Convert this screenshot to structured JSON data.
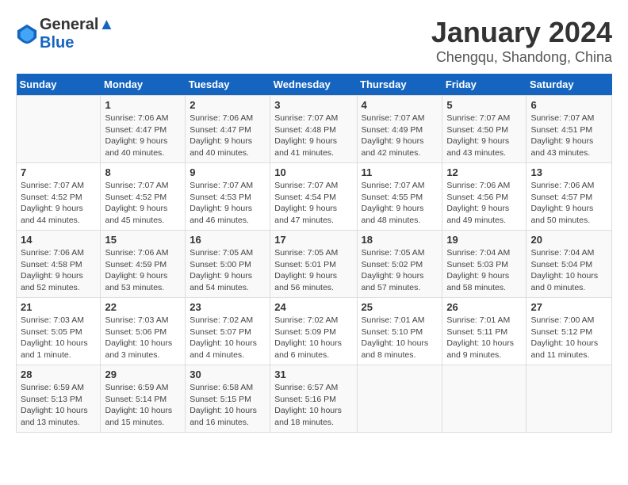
{
  "header": {
    "logo_line1": "General",
    "logo_line2": "Blue",
    "month": "January 2024",
    "location": "Chengqu, Shandong, China"
  },
  "weekdays": [
    "Sunday",
    "Monday",
    "Tuesday",
    "Wednesday",
    "Thursday",
    "Friday",
    "Saturday"
  ],
  "weeks": [
    [
      {
        "day": "",
        "sunrise": "",
        "sunset": "",
        "daylight": ""
      },
      {
        "day": "1",
        "sunrise": "Sunrise: 7:06 AM",
        "sunset": "Sunset: 4:47 PM",
        "daylight": "Daylight: 9 hours and 40 minutes."
      },
      {
        "day": "2",
        "sunrise": "Sunrise: 7:06 AM",
        "sunset": "Sunset: 4:47 PM",
        "daylight": "Daylight: 9 hours and 40 minutes."
      },
      {
        "day": "3",
        "sunrise": "Sunrise: 7:07 AM",
        "sunset": "Sunset: 4:48 PM",
        "daylight": "Daylight: 9 hours and 41 minutes."
      },
      {
        "day": "4",
        "sunrise": "Sunrise: 7:07 AM",
        "sunset": "Sunset: 4:49 PM",
        "daylight": "Daylight: 9 hours and 42 minutes."
      },
      {
        "day": "5",
        "sunrise": "Sunrise: 7:07 AM",
        "sunset": "Sunset: 4:50 PM",
        "daylight": "Daylight: 9 hours and 43 minutes."
      },
      {
        "day": "6",
        "sunrise": "Sunrise: 7:07 AM",
        "sunset": "Sunset: 4:51 PM",
        "daylight": "Daylight: 9 hours and 43 minutes."
      }
    ],
    [
      {
        "day": "7",
        "sunrise": "Sunrise: 7:07 AM",
        "sunset": "Sunset: 4:52 PM",
        "daylight": "Daylight: 9 hours and 44 minutes."
      },
      {
        "day": "8",
        "sunrise": "Sunrise: 7:07 AM",
        "sunset": "Sunset: 4:52 PM",
        "daylight": "Daylight: 9 hours and 45 minutes."
      },
      {
        "day": "9",
        "sunrise": "Sunrise: 7:07 AM",
        "sunset": "Sunset: 4:53 PM",
        "daylight": "Daylight: 9 hours and 46 minutes."
      },
      {
        "day": "10",
        "sunrise": "Sunrise: 7:07 AM",
        "sunset": "Sunset: 4:54 PM",
        "daylight": "Daylight: 9 hours and 47 minutes."
      },
      {
        "day": "11",
        "sunrise": "Sunrise: 7:07 AM",
        "sunset": "Sunset: 4:55 PM",
        "daylight": "Daylight: 9 hours and 48 minutes."
      },
      {
        "day": "12",
        "sunrise": "Sunrise: 7:06 AM",
        "sunset": "Sunset: 4:56 PM",
        "daylight": "Daylight: 9 hours and 49 minutes."
      },
      {
        "day": "13",
        "sunrise": "Sunrise: 7:06 AM",
        "sunset": "Sunset: 4:57 PM",
        "daylight": "Daylight: 9 hours and 50 minutes."
      }
    ],
    [
      {
        "day": "14",
        "sunrise": "Sunrise: 7:06 AM",
        "sunset": "Sunset: 4:58 PM",
        "daylight": "Daylight: 9 hours and 52 minutes."
      },
      {
        "day": "15",
        "sunrise": "Sunrise: 7:06 AM",
        "sunset": "Sunset: 4:59 PM",
        "daylight": "Daylight: 9 hours and 53 minutes."
      },
      {
        "day": "16",
        "sunrise": "Sunrise: 7:05 AM",
        "sunset": "Sunset: 5:00 PM",
        "daylight": "Daylight: 9 hours and 54 minutes."
      },
      {
        "day": "17",
        "sunrise": "Sunrise: 7:05 AM",
        "sunset": "Sunset: 5:01 PM",
        "daylight": "Daylight: 9 hours and 56 minutes."
      },
      {
        "day": "18",
        "sunrise": "Sunrise: 7:05 AM",
        "sunset": "Sunset: 5:02 PM",
        "daylight": "Daylight: 9 hours and 57 minutes."
      },
      {
        "day": "19",
        "sunrise": "Sunrise: 7:04 AM",
        "sunset": "Sunset: 5:03 PM",
        "daylight": "Daylight: 9 hours and 58 minutes."
      },
      {
        "day": "20",
        "sunrise": "Sunrise: 7:04 AM",
        "sunset": "Sunset: 5:04 PM",
        "daylight": "Daylight: 10 hours and 0 minutes."
      }
    ],
    [
      {
        "day": "21",
        "sunrise": "Sunrise: 7:03 AM",
        "sunset": "Sunset: 5:05 PM",
        "daylight": "Daylight: 10 hours and 1 minute."
      },
      {
        "day": "22",
        "sunrise": "Sunrise: 7:03 AM",
        "sunset": "Sunset: 5:06 PM",
        "daylight": "Daylight: 10 hours and 3 minutes."
      },
      {
        "day": "23",
        "sunrise": "Sunrise: 7:02 AM",
        "sunset": "Sunset: 5:07 PM",
        "daylight": "Daylight: 10 hours and 4 minutes."
      },
      {
        "day": "24",
        "sunrise": "Sunrise: 7:02 AM",
        "sunset": "Sunset: 5:09 PM",
        "daylight": "Daylight: 10 hours and 6 minutes."
      },
      {
        "day": "25",
        "sunrise": "Sunrise: 7:01 AM",
        "sunset": "Sunset: 5:10 PM",
        "daylight": "Daylight: 10 hours and 8 minutes."
      },
      {
        "day": "26",
        "sunrise": "Sunrise: 7:01 AM",
        "sunset": "Sunset: 5:11 PM",
        "daylight": "Daylight: 10 hours and 9 minutes."
      },
      {
        "day": "27",
        "sunrise": "Sunrise: 7:00 AM",
        "sunset": "Sunset: 5:12 PM",
        "daylight": "Daylight: 10 hours and 11 minutes."
      }
    ],
    [
      {
        "day": "28",
        "sunrise": "Sunrise: 6:59 AM",
        "sunset": "Sunset: 5:13 PM",
        "daylight": "Daylight: 10 hours and 13 minutes."
      },
      {
        "day": "29",
        "sunrise": "Sunrise: 6:59 AM",
        "sunset": "Sunset: 5:14 PM",
        "daylight": "Daylight: 10 hours and 15 minutes."
      },
      {
        "day": "30",
        "sunrise": "Sunrise: 6:58 AM",
        "sunset": "Sunset: 5:15 PM",
        "daylight": "Daylight: 10 hours and 16 minutes."
      },
      {
        "day": "31",
        "sunrise": "Sunrise: 6:57 AM",
        "sunset": "Sunset: 5:16 PM",
        "daylight": "Daylight: 10 hours and 18 minutes."
      },
      {
        "day": "",
        "sunrise": "",
        "sunset": "",
        "daylight": ""
      },
      {
        "day": "",
        "sunrise": "",
        "sunset": "",
        "daylight": ""
      },
      {
        "day": "",
        "sunrise": "",
        "sunset": "",
        "daylight": ""
      }
    ]
  ]
}
